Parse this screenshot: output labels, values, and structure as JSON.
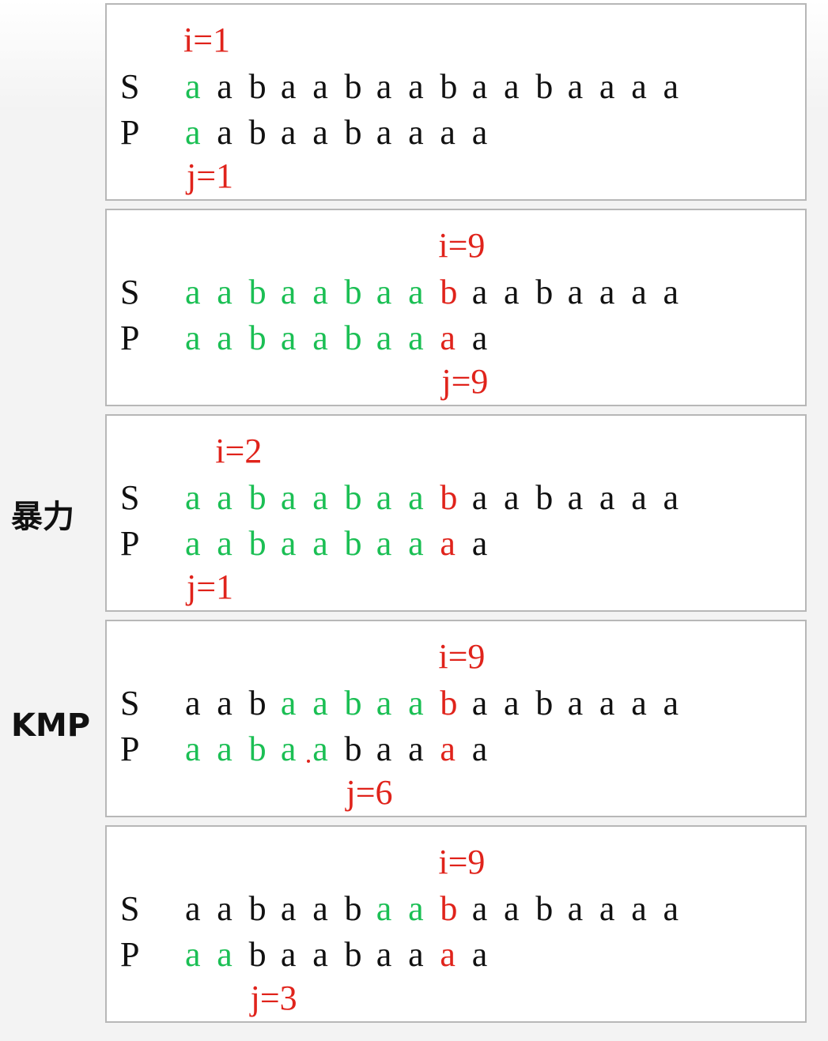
{
  "labels": {
    "brute": "暴力",
    "kmp": "KMP",
    "s_row": "S",
    "p_row": "P"
  },
  "strings": {
    "S": "aabaabaabaabaaaa",
    "P": "aabaabaaaa"
  },
  "colors": {
    "match": "#1bbf54",
    "mismatch": "#e0231b",
    "pointer": "#e0231b",
    "normal": "#111111"
  },
  "panels": [
    {
      "i_label": "i=1",
      "j_label": "j=1",
      "i_index": 1,
      "j_index": 1,
      "p_offset": 0,
      "s_green": [
        1
      ],
      "s_red": [],
      "p_green": [
        1
      ],
      "p_red": []
    },
    {
      "i_label": "i=9",
      "j_label": "j=9",
      "i_index": 9,
      "j_index": 9,
      "p_offset": 0,
      "s_green": [
        1,
        2,
        3,
        4,
        5,
        6,
        7,
        8
      ],
      "s_red": [
        9
      ],
      "p_green": [
        1,
        2,
        3,
        4,
        5,
        6,
        7,
        8
      ],
      "p_red": [
        9
      ]
    },
    {
      "i_label": "i=2",
      "j_label": "j=1",
      "i_index": 2,
      "j_index": 1,
      "p_offset": 0,
      "s_green": [
        1,
        2,
        3,
        4,
        5,
        6,
        7,
        8
      ],
      "s_red": [
        9
      ],
      "p_green": [
        1,
        2,
        3,
        4,
        5,
        6,
        7,
        8
      ],
      "p_red": [
        9
      ]
    },
    {
      "i_label": "i=9",
      "j_label": "j=6",
      "i_index": 9,
      "j_index": 6,
      "p_offset": 0,
      "s_green": [
        4,
        5,
        6,
        7,
        8
      ],
      "s_red": [
        9
      ],
      "p_green": [
        1,
        2,
        3,
        4,
        5
      ],
      "p_red": [
        9
      ],
      "p_dot_under": 5
    },
    {
      "i_label": "i=9",
      "j_label": "j=3",
      "i_index": 9,
      "j_index": 3,
      "p_offset": 0,
      "s_green": [
        7,
        8
      ],
      "s_red": [
        9
      ],
      "p_green": [
        1,
        2
      ],
      "p_red": [
        9
      ]
    }
  ]
}
